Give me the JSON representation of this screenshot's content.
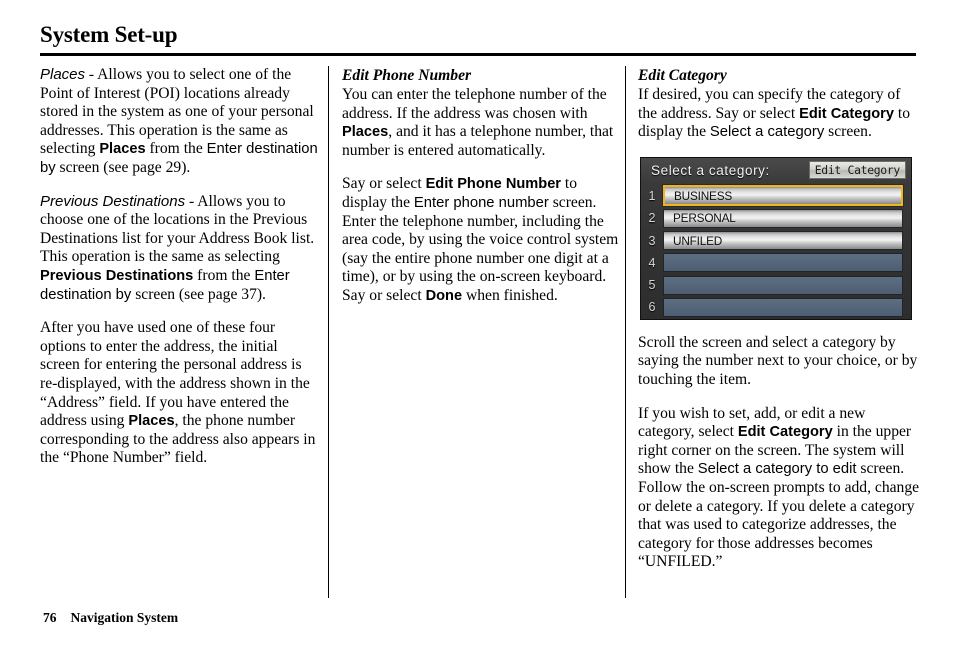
{
  "header": {
    "title": "System Set-up"
  },
  "footer": {
    "page_number": "76",
    "book_title": "Navigation System"
  },
  "columns": {
    "col1": {
      "para1": {
        "term": "Places",
        "dash": " - ",
        "t1": "Allows you to select one of the Point of Interest (POI) locations already stored in the system as one of your personal addresses. This operation is the same as selecting ",
        "cmd1": "Places",
        "t2": " from the ",
        "scr1": "Enter destination by",
        "t3": " screen (see page 29)."
      },
      "para2": {
        "term": "Previous Destinations",
        "dash": " - ",
        "t1": "Allows you to choose one of the locations in the Previous Destinations list for your Address Book list. This operation is the same as selecting ",
        "cmd1": "Previous Destinations",
        "t2": " from the ",
        "scr1": "Enter destination by",
        "t3": " screen (see page 37)."
      },
      "para3": {
        "t1": "After you have used one of these four options to enter the address, the initial screen for entering the personal address is re-displayed, with the address shown in the “Address” field. If you have entered the address using ",
        "cmd1": "Places",
        "t2": ", the phone number corresponding to the address also appears in the “Phone Number” field."
      }
    },
    "col2": {
      "heading": "Edit Phone Number",
      "para1": {
        "t1": "You can enter the telephone number of the address. If the address was chosen with ",
        "cmd1": "Places",
        "t2": ", and it has a telephone number, that number is entered automatically."
      },
      "para2": {
        "t1": "Say or select ",
        "cmd1": "Edit Phone Number",
        "t2": " to display the ",
        "scr1": "Enter phone number",
        "t3": " screen. Enter the telephone number, including the area code, by using the voice control system (say the entire phone number one digit at a time), or by using the on-screen keyboard. Say or select ",
        "cmd2": "Done",
        "t4": " when finished."
      }
    },
    "col3": {
      "heading": "Edit Category",
      "para1": {
        "t1": "If desired, you can specify the category of the address. Say or select ",
        "cmd1": "Edit Category",
        "t2": " to display the ",
        "scr1": "Select a category",
        "t3": " screen."
      },
      "para2": {
        "t1": "Scroll the screen and select a category by saying the number next to your choice, or by touching the item."
      },
      "para3": {
        "t1": "If you wish to set, add, or edit a new category, select ",
        "cmd1": "Edit Category",
        "t2": " in the upper right corner on the screen. The system will show the ",
        "scr1": "Select a category to edit",
        "t3": " screen. Follow the on-screen prompts to add, change or delete a category. If you delete a category that was used to categorize addresses, the category for those addresses becomes “UNFILED.”"
      }
    }
  },
  "nav_screen": {
    "title": "Select a category:",
    "edit_button": "Edit Category",
    "rows": [
      {
        "number": "1",
        "label": "BUSINESS",
        "filled": true,
        "selected": true
      },
      {
        "number": "2",
        "label": "PERSONAL",
        "filled": true,
        "selected": false
      },
      {
        "number": "3",
        "label": "UNFILED",
        "filled": true,
        "selected": false
      },
      {
        "number": "4",
        "label": "",
        "filled": false,
        "selected": false
      },
      {
        "number": "5",
        "label": "",
        "filled": false,
        "selected": false
      },
      {
        "number": "6",
        "label": "",
        "filled": false,
        "selected": false
      }
    ],
    "colors": {
      "screen_bg": "#333333",
      "selection_border": "#f0b51c",
      "empty_row": "#55657a",
      "button_silver": "#e0e0e0"
    }
  }
}
